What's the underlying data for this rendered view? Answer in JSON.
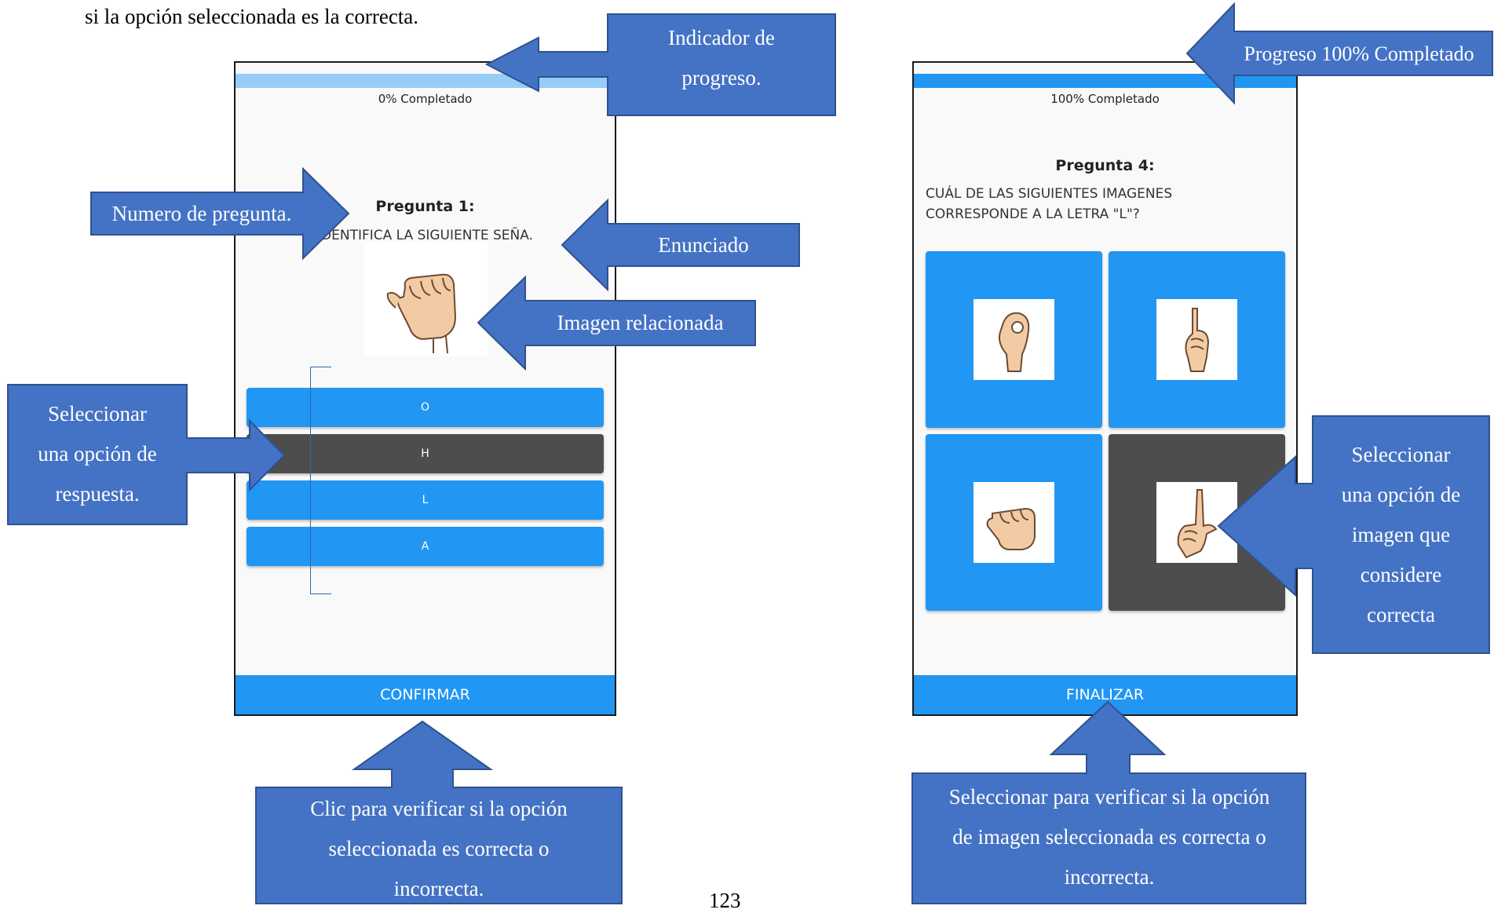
{
  "document": {
    "intro_text": "si la opción seleccionada es la correcta.",
    "page_number": "123"
  },
  "colors": {
    "callout_fill": "#4472c4",
    "callout_border": "#2f528f",
    "primary_blue": "#2196f3",
    "progress_track": "#97ccf7",
    "selected_gray": "#4d4d4d"
  },
  "screen1": {
    "progress_text": "0% Completado",
    "progress_value": 0,
    "question_title": "Pregunta 1:",
    "question_text": "IDENTIFICA LA SIGUIENTE SEÑA.",
    "image_icon": "hand-sign-letter-a-icon",
    "options": [
      {
        "label": "O",
        "selected": false
      },
      {
        "label": "H",
        "selected": true
      },
      {
        "label": "L",
        "selected": false
      },
      {
        "label": "A",
        "selected": false
      }
    ],
    "confirm_label": "CONFIRMAR"
  },
  "screen2": {
    "progress_text": "100% Completado",
    "progress_value": 1,
    "question_title": "Pregunta 4:",
    "question_text_line1": "CUÁL DE LAS SIGUIENTES IMAGENES",
    "question_text_line2": "CORRESPONDE A LA LETRA \"L\"?",
    "image_options": [
      {
        "icon": "hand-sign-letter-o-icon",
        "selected": false
      },
      {
        "icon": "hand-sign-letter-d-icon",
        "selected": false
      },
      {
        "icon": "hand-sign-letter-a-icon",
        "selected": false
      },
      {
        "icon": "hand-sign-letter-l-icon",
        "selected": true
      }
    ],
    "finish_label": "FINALIZAR"
  },
  "callouts": {
    "progress_indicator": [
      "Indicador de",
      "progreso."
    ],
    "question_number": "Numero de pregunta.",
    "statement": "Enunciado",
    "related_image": "Imagen relacionada",
    "select_answer": [
      "Seleccionar",
      "una opción de",
      "respuesta."
    ],
    "confirm_click": [
      "Clic para verificar si la opción",
      "seleccionada es correcta o",
      "incorrecta."
    ],
    "progress_complete": "Progreso 100% Completado",
    "select_image": [
      "Seleccionar",
      "una opción de",
      "imagen que",
      "considere",
      "correcta"
    ],
    "verify_image": [
      "Seleccionar para verificar si la opción",
      "de imagen seleccionada es correcta o",
      "incorrecta."
    ]
  }
}
